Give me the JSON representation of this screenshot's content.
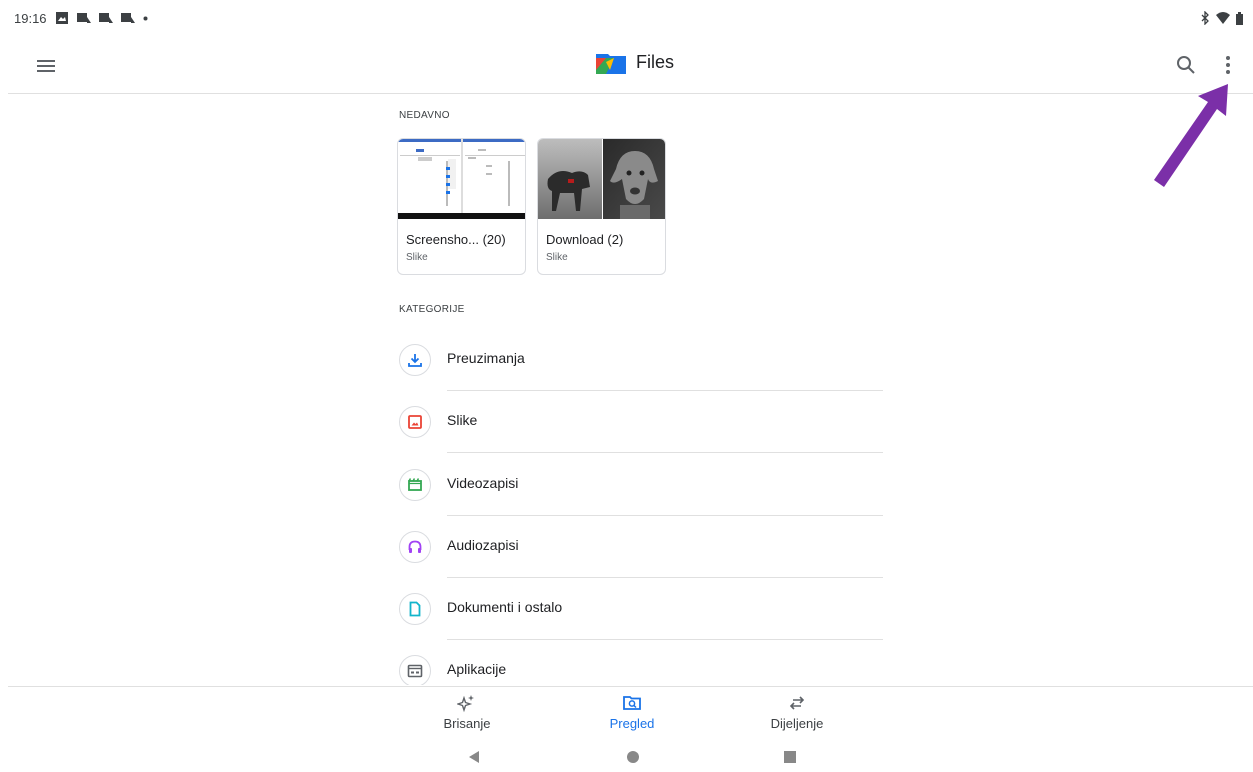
{
  "status_bar": {
    "time": "19:16"
  },
  "app_bar": {
    "title": "Files",
    "menu_icon": "hamburger-menu-icon",
    "search_icon": "search-icon",
    "more_icon": "more-vert-icon"
  },
  "recent": {
    "heading": "NEDAVNO",
    "cards": [
      {
        "title": "Screensho... (20)",
        "subtitle": "Slike"
      },
      {
        "title": "Download (2)",
        "subtitle": "Slike"
      }
    ]
  },
  "categories": {
    "heading": "KATEGORIJE",
    "items": [
      {
        "label": "Preuzimanja",
        "icon": "download-icon",
        "color": "#1a73e8"
      },
      {
        "label": "Slike",
        "icon": "image-icon",
        "color": "#ea4335"
      },
      {
        "label": "Videozapisi",
        "icon": "video-icon",
        "color": "#34a853"
      },
      {
        "label": "Audiozapisi",
        "icon": "headphones-icon",
        "color": "#a142f4"
      },
      {
        "label": "Dokumenti i ostalo",
        "icon": "document-icon",
        "color": "#12b5cb"
      },
      {
        "label": "Aplikacije",
        "icon": "apps-icon",
        "color": "#5f6368"
      }
    ]
  },
  "bottom_nav": {
    "items": [
      {
        "label": "Brisanje",
        "icon": "sparkle-clean-icon"
      },
      {
        "label": "Pregled",
        "icon": "browse-folder-icon",
        "active": true
      },
      {
        "label": "Dijeljenje",
        "icon": "share-swap-icon"
      }
    ]
  },
  "colors": {
    "accent": "#1a73e8",
    "annotation_arrow": "#7b2fa8"
  }
}
